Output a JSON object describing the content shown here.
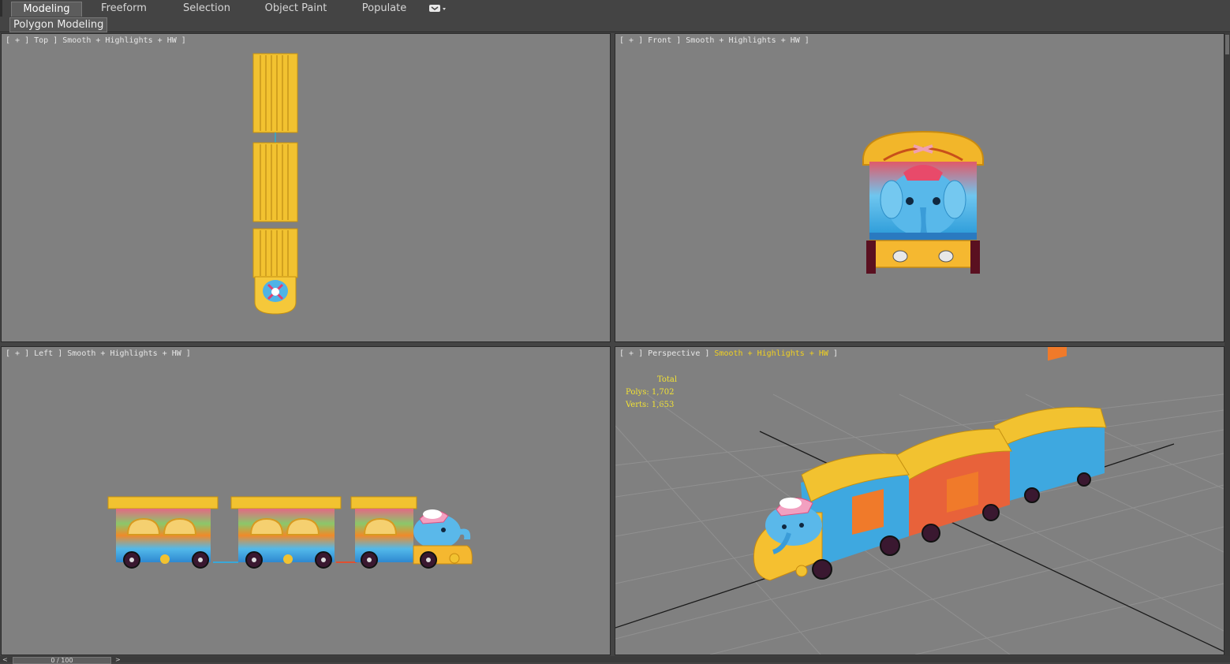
{
  "ribbon": {
    "tabs": [
      {
        "label": "Modeling",
        "active": true
      },
      {
        "label": "Freeform",
        "active": false
      },
      {
        "label": "Selection",
        "active": false
      },
      {
        "label": "Object Paint",
        "active": false
      },
      {
        "label": "Populate",
        "active": false
      }
    ],
    "panel_label": "Polygon Modeling"
  },
  "viewports": {
    "top": {
      "label": "[ + ] Top ] Smooth + Highlights + HW ]"
    },
    "front": {
      "label": "[ + ] Front ] Smooth + Highlights + HW ]"
    },
    "left": {
      "label": "[ + ] Left ] Smooth + Highlights + HW ]"
    },
    "perspective": {
      "label_prefix": "[ + ] Perspective ] ",
      "label_shading": "Smooth + Highlights + HW",
      "label_suffix": " ]",
      "stats": {
        "total_label": "Total",
        "polys": "Polys: 1,702",
        "verts": "Verts: 1,653"
      }
    }
  },
  "timeline": {
    "frame": "0 / 100",
    "prev": "<",
    "next": ">"
  },
  "colors": {
    "viewport_bg": "#808080",
    "ui_bg": "#444444",
    "stats_text": "#f2e233",
    "train_yellow": "#f2c230",
    "elephant_blue": "#4fb3e6"
  }
}
